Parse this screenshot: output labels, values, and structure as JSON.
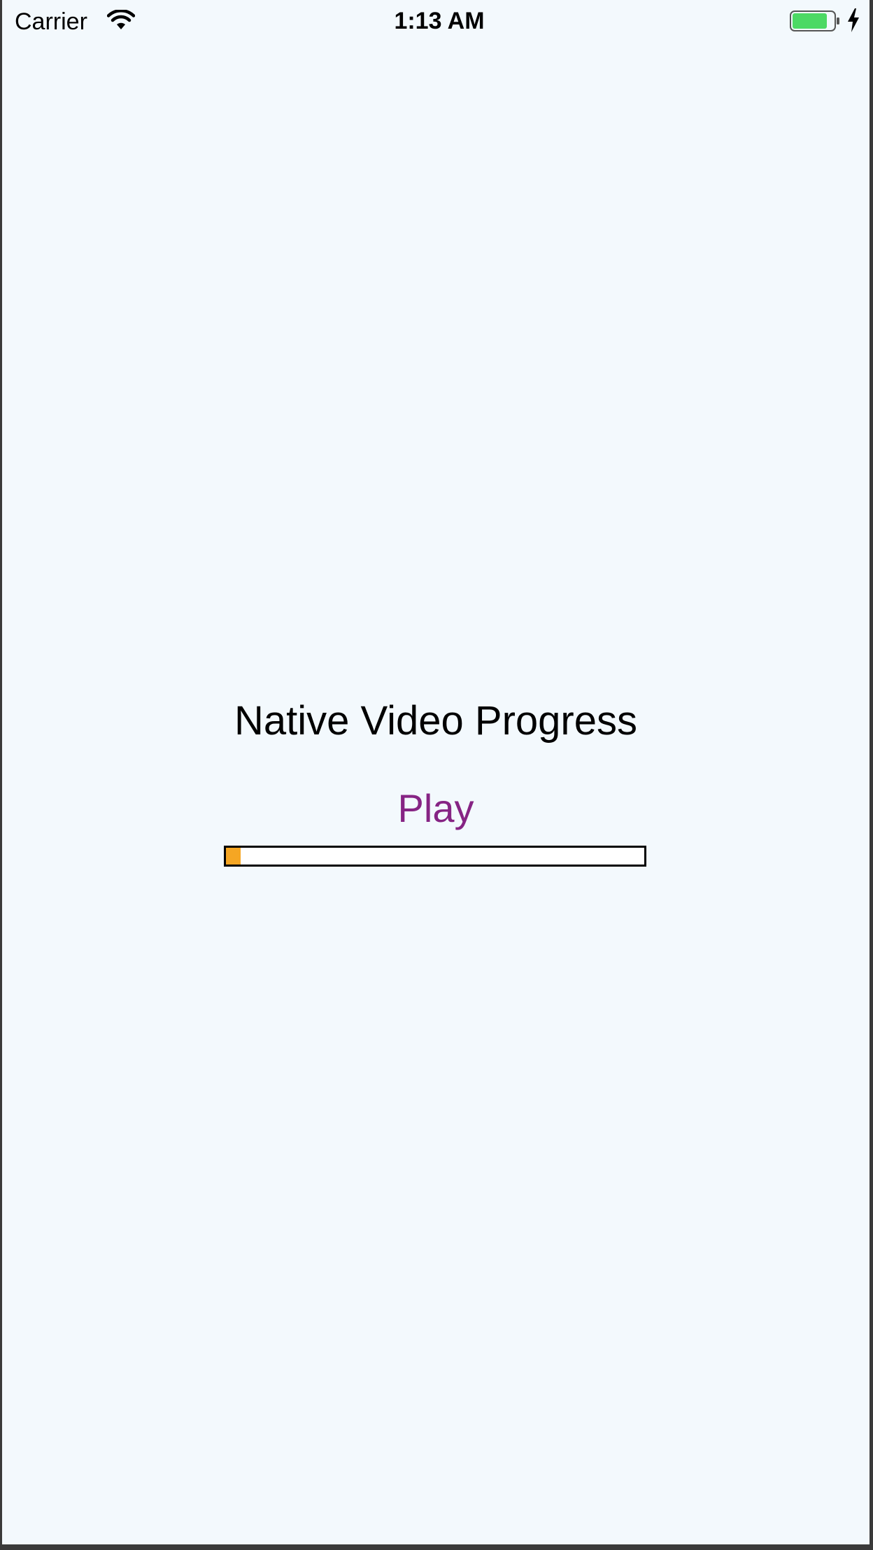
{
  "status_bar": {
    "carrier": "Carrier",
    "time": "1:13 AM",
    "wifi_icon": "wifi-icon",
    "battery_icon": "battery-icon",
    "charging_icon": "charging-bolt-icon",
    "battery_color": "#4cd964"
  },
  "main": {
    "title": "Native Video Progress",
    "play_label": "Play",
    "play_color": "#862484",
    "progress": {
      "fraction": 0.035,
      "fill_color": "#f5a623",
      "track_color": "#ffffff",
      "border_color": "#000000"
    }
  },
  "colors": {
    "background": "#f3f9fd"
  }
}
